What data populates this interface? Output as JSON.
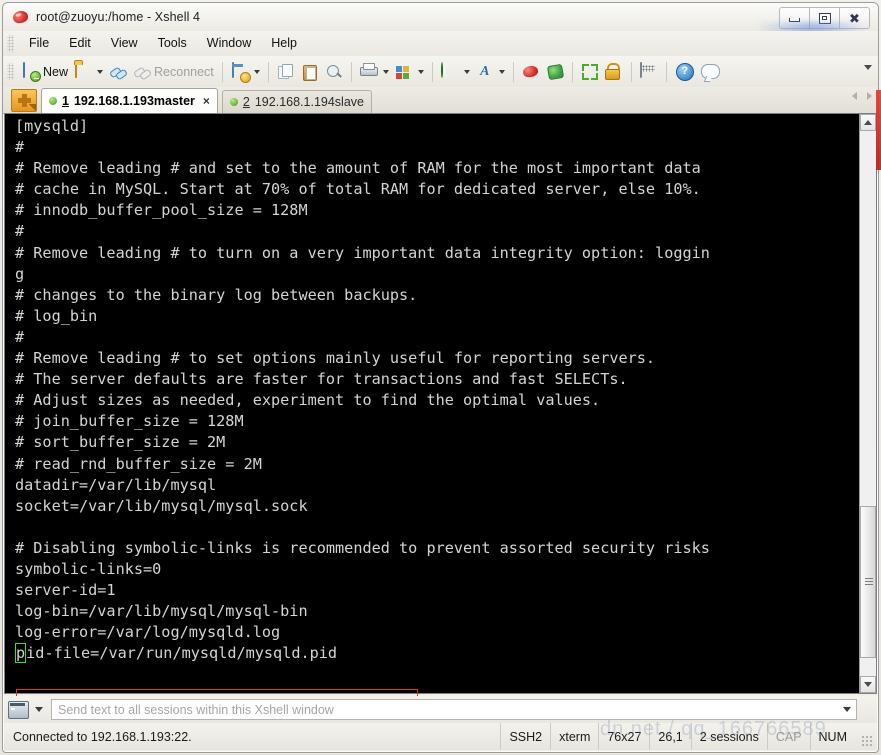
{
  "window": {
    "title": "root@zuoyu:/home - Xshell 4",
    "icon": "xshell-logo-icon",
    "minimize_label": "–",
    "maximize_label": "❐",
    "close_label": "✕"
  },
  "menu": {
    "items": [
      {
        "label": "File"
      },
      {
        "label": "Edit"
      },
      {
        "label": "View"
      },
      {
        "label": "Tools"
      },
      {
        "label": "Window"
      },
      {
        "label": "Help"
      }
    ]
  },
  "toolbar": {
    "new_label": "New",
    "reconnect_label": "Reconnect",
    "font_glyph": "A",
    "help_glyph": "?",
    "buttons": [
      {
        "name": "new-session-button",
        "icon": "new-file-icon",
        "label": "New"
      },
      {
        "name": "open-session-button",
        "icon": "open-folder-icon"
      },
      {
        "name": "connect-button",
        "icon": "connect-link-icon"
      },
      {
        "name": "reconnect-button",
        "icon": "reconnect-link-icon",
        "label": "Reconnect"
      },
      {
        "name": "session-manager-button",
        "icon": "session-window-icon"
      },
      {
        "name": "copy-button",
        "icon": "copy-icon"
      },
      {
        "name": "paste-button",
        "icon": "paste-icon"
      },
      {
        "name": "find-button",
        "icon": "magnifier-icon"
      },
      {
        "name": "print-button",
        "icon": "printer-icon"
      },
      {
        "name": "layout-button",
        "icon": "layout-tiles-icon"
      },
      {
        "name": "global-options-button",
        "icon": "globe-icon"
      },
      {
        "name": "font-button",
        "icon": "font-a-icon"
      },
      {
        "name": "xshell-button",
        "icon": "xshell-logo-icon"
      },
      {
        "name": "xftp-button",
        "icon": "xftp-icon"
      },
      {
        "name": "fullscreen-button",
        "icon": "fullscreen-arrows-icon"
      },
      {
        "name": "lock-button",
        "icon": "lock-icon"
      },
      {
        "name": "keyboard-button",
        "icon": "keyboard-icon"
      },
      {
        "name": "help-button",
        "icon": "help-circle-icon"
      },
      {
        "name": "chat-button",
        "icon": "chat-bubble-icon"
      }
    ]
  },
  "tabs": {
    "new_tab_icon": "plus-icon",
    "close_glyph": "×",
    "items": [
      {
        "num": "1",
        "title": "192.168.1.193master",
        "active": true
      },
      {
        "num": "2",
        "title": "192.168.1.194slave",
        "active": false
      }
    ]
  },
  "terminal": {
    "cursor_char": "p",
    "lines": [
      "[mysqld]",
      "#",
      "# Remove leading # and set to the amount of RAM for the most important data",
      "# cache in MySQL. Start at 70% of total RAM for dedicated server, else 10%.",
      "# innodb_buffer_pool_size = 128M",
      "#",
      "# Remove leading # to turn on a very important data integrity option: loggin",
      "g",
      "# changes to the binary log between backups.",
      "# log_bin",
      "#",
      "# Remove leading # to set options mainly useful for reporting servers.",
      "# The server defaults are faster for transactions and fast SELECTs.",
      "# Adjust sizes as needed, experiment to find the optimal values.",
      "# join_buffer_size = 128M",
      "# sort_buffer_size = 2M",
      "# read_rnd_buffer_size = 2M",
      "datadir=/var/lib/mysql",
      "socket=/var/lib/mysql/mysql.sock",
      "",
      "# Disabling symbolic-links is recommended to prevent assorted security risks",
      "symbolic-links=0",
      "server-id=1",
      "log-bin=/var/lib/mysql/mysql-bin",
      "log-error=/var/log/mysqld.log"
    ],
    "cursor_line": "id-file=/var/run/mysqld/mysqld.pid",
    "highlight_color": "#d9352f",
    "cursor_color": "#2ee62e",
    "text_color": "#d4d4d4",
    "background_color": "#000000"
  },
  "send_bar": {
    "icon": "terminal-monitor-icon",
    "placeholder": "Send text to all sessions within this Xshell window"
  },
  "status_bar": {
    "message": "Connected to 192.168.1.193:22.",
    "cells": [
      {
        "name": "status-protocol",
        "label": "SSH2",
        "dim": false
      },
      {
        "name": "status-terminal-type",
        "label": "xterm",
        "dim": false
      },
      {
        "name": "status-size",
        "label": "76x27",
        "dim": false
      },
      {
        "name": "status-cursor-pos",
        "label": "26,1",
        "dim": false
      },
      {
        "name": "status-sessions",
        "label": "2 sessions",
        "dim": false
      },
      {
        "name": "status-caps-lock",
        "label": "CAP",
        "dim": true
      },
      {
        "name": "status-num-lock",
        "label": "NUM",
        "dim": false
      }
    ]
  },
  "watermark": {
    "text": "dn.net / qq_166766589"
  }
}
